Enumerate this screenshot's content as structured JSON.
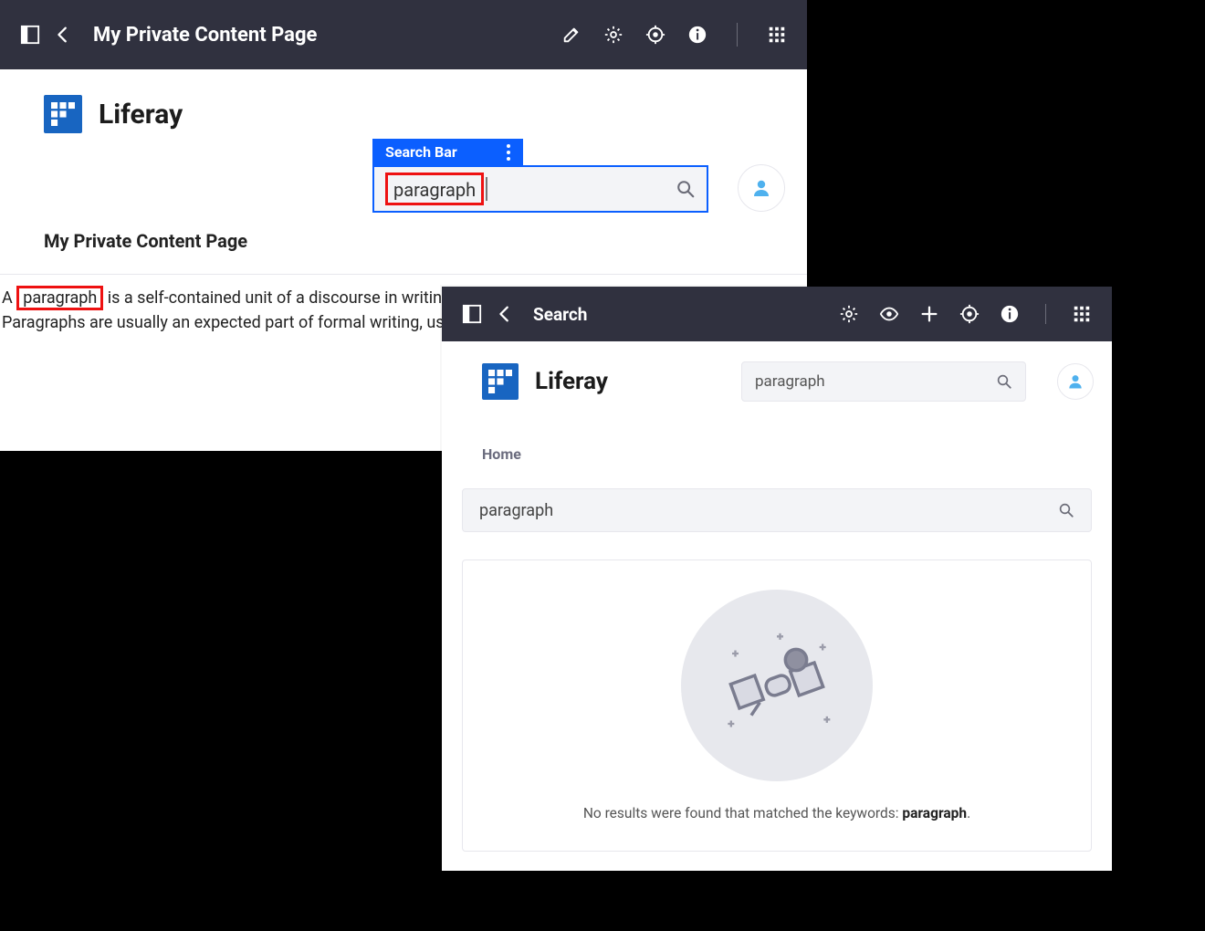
{
  "panel1": {
    "toolbar_title": "My Private Content Page",
    "brand_name": "Liferay",
    "search_fragment_label": "Search Bar",
    "search_value": "paragraph",
    "heading": "My Private Content Page",
    "para_pre": "A",
    "para_hl": "paragraph",
    "para_rest1": " is a self-contained unit of a discourse in writing dealing with a particular point or idea.",
    "para_line2": "Paragraphs are usually an expected part of formal writing, used to organize longer prose."
  },
  "panel2": {
    "toolbar_title": "Search",
    "brand_name": "Liferay",
    "search_value": "paragraph",
    "breadcrumb": "Home",
    "searchbar_value": "paragraph",
    "empty_msg_pre": "No results were found that matched the keywords: ",
    "empty_msg_kw": "paragraph",
    "empty_msg_post": "."
  }
}
